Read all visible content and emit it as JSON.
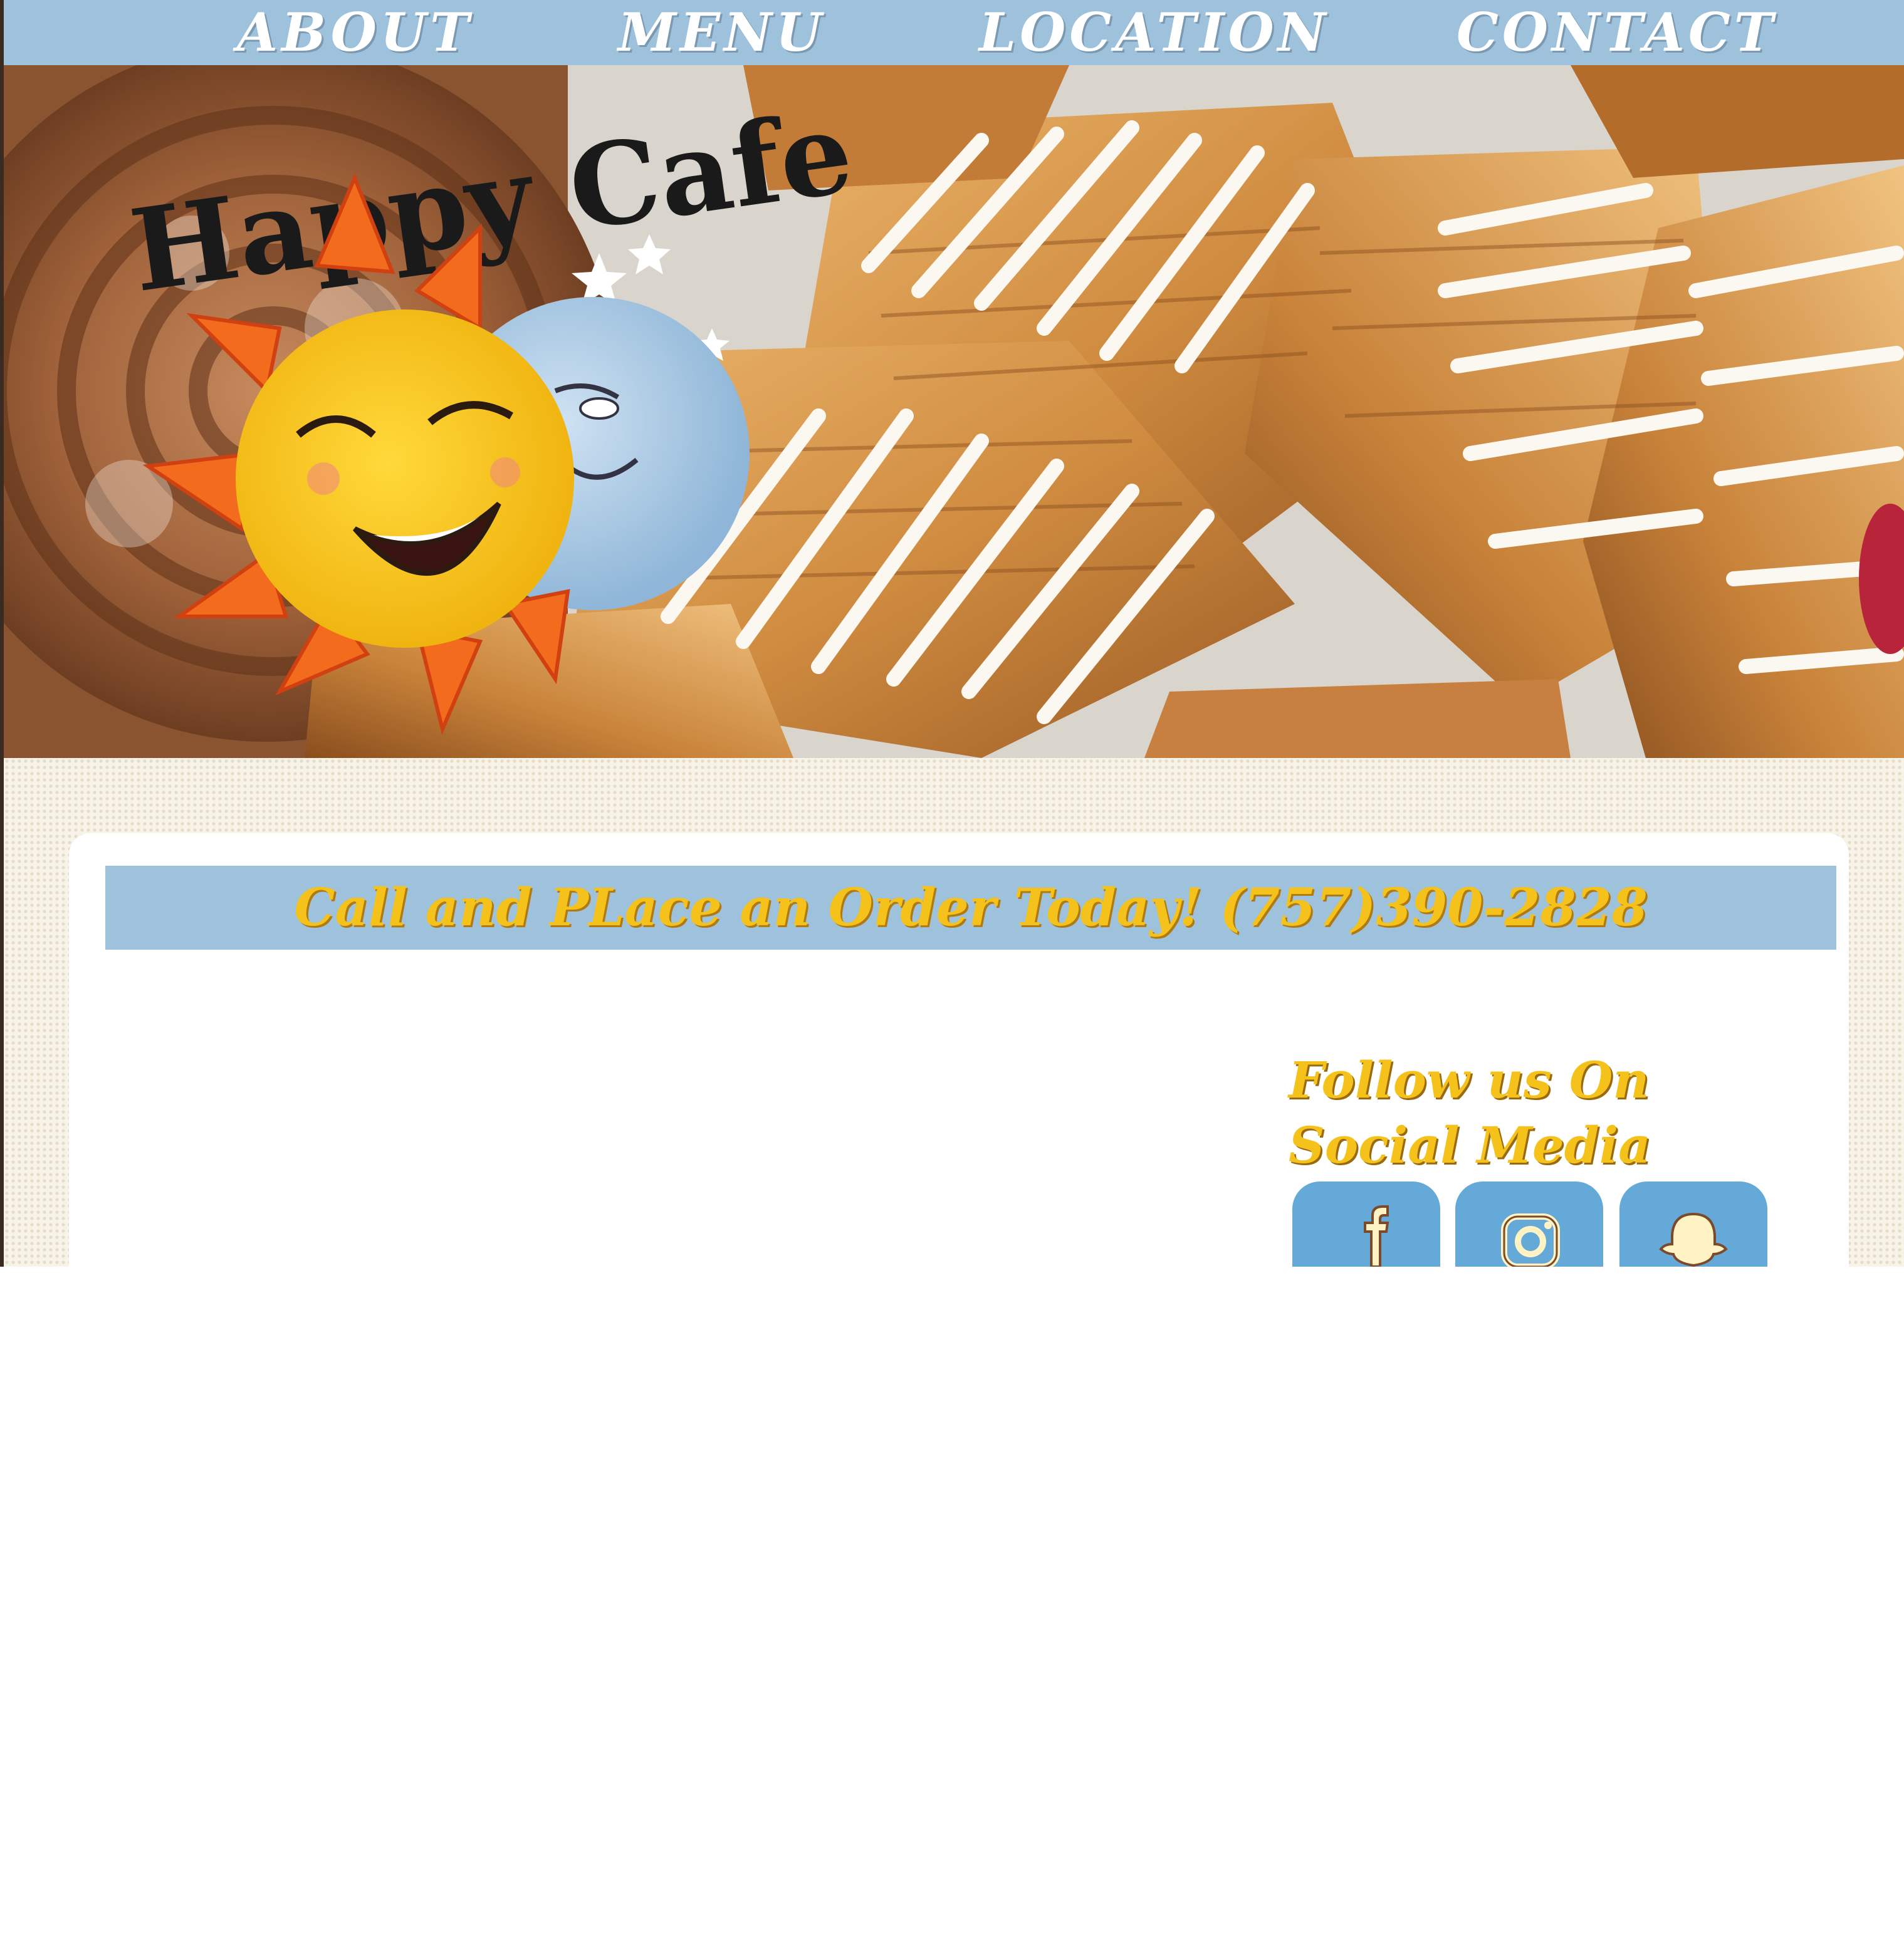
{
  "nav": {
    "items": [
      {
        "label": "ABOUT"
      },
      {
        "label": "MENU"
      },
      {
        "label": "LOCATION"
      },
      {
        "label": "CONTACT"
      }
    ]
  },
  "hero": {
    "logo_text": "Happy Cafe"
  },
  "order": {
    "text": "Call and PLace an Order Today! (757)390-2828"
  },
  "social": {
    "title": "Follow us On Social Media",
    "icons": [
      "facebook-icon",
      "instagram-icon",
      "snapchat-icon"
    ]
  },
  "colors": {
    "nav_bg": "#9ec1dc",
    "accent_yellow": "#f4c21a",
    "social_btn": "#65a9d8"
  }
}
